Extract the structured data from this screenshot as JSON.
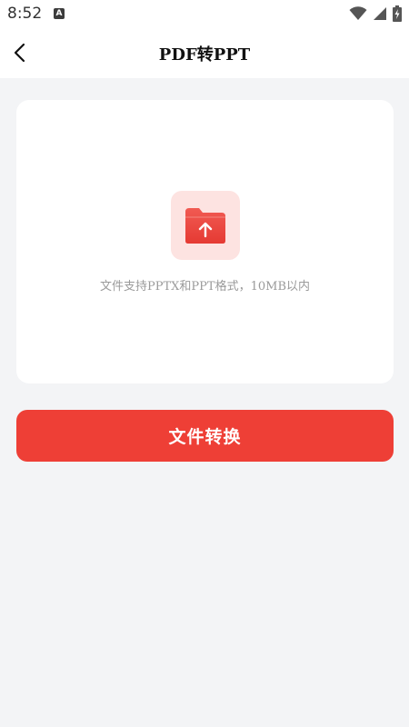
{
  "status_bar": {
    "time": "8:52",
    "notification_icon": "a-letter-icon",
    "notification_letter": "A",
    "icons": [
      "wifi-icon",
      "cellular-signal-icon",
      "battery-charging-icon"
    ]
  },
  "nav": {
    "title": "PDF转PPT",
    "back_icon": "chevron-left-icon"
  },
  "upload": {
    "icon": "folder-upload-icon",
    "hint": "文件支持PPTX和PPT格式，10MB以内"
  },
  "actions": {
    "convert_label": "文件转换"
  },
  "colors": {
    "accent": "#ee3f36",
    "icon_bg": "#fde3e1",
    "background": "#f3f4f6",
    "card": "#ffffff",
    "hint_text": "#9a9a9a"
  }
}
